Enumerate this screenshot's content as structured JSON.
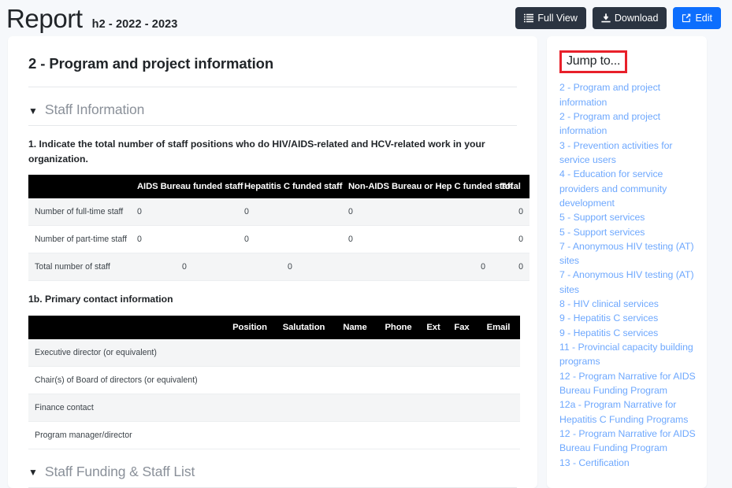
{
  "header": {
    "title": "Report",
    "subtitle": "h2 - 2022 - 2023",
    "buttons": {
      "full_view": "Full View",
      "download": "Download",
      "edit": "Edit"
    },
    "colors": {
      "dark_button": "#2b3441",
      "primary_button": "#0d6efd",
      "page_background": "#f6f8fb"
    }
  },
  "main": {
    "section_title": "2 - Program and project information",
    "accordions": [
      {
        "label": "Staff Information",
        "expanded": true
      },
      {
        "label": "Staff Funding & Staff List",
        "expanded": true
      }
    ],
    "question_1": "1. Indicate the total number of staff positions who do HIV/AIDS-related and HCV-related work in your organization.",
    "staff_table": {
      "columns": [
        "",
        "AIDS Bureau funded staff",
        "Hepatitis C funded staff",
        "Non-AIDS Bureau or Hep C funded staff",
        "Total"
      ],
      "rows": [
        {
          "label": "Number of full-time staff",
          "values": [
            "0",
            "0",
            "0",
            "0"
          ],
          "align": "left"
        },
        {
          "label": "Number of part-time staff",
          "values": [
            "0",
            "0",
            "0",
            "0"
          ],
          "align": "left"
        },
        {
          "label": "Total number of staff",
          "values": [
            "0",
            "0",
            "0",
            "0"
          ],
          "align": "center"
        }
      ]
    },
    "question_1b": "1b. Primary contact information",
    "contact_table": {
      "columns": [
        "",
        "Position",
        "Salutation",
        "Name",
        "Phone",
        "Ext",
        "Fax",
        "Email"
      ],
      "rows": [
        {
          "label": "Executive director (or equivalent)",
          "values": [
            "",
            "",
            "",
            "",
            "",
            "",
            ""
          ]
        },
        {
          "label": "Chair(s) of Board of directors (or equivalent)",
          "values": [
            "",
            "",
            "",
            "",
            "",
            "",
            ""
          ]
        },
        {
          "label": "Finance contact",
          "values": [
            "",
            "",
            "",
            "",
            "",
            "",
            ""
          ]
        },
        {
          "label": "Program manager/director",
          "values": [
            "",
            "",
            "",
            "",
            "",
            "",
            ""
          ]
        }
      ]
    }
  },
  "sidebar": {
    "heading": "Jump to...",
    "heading_highlight_color": "#e8202a",
    "link_color": "#6ea8fe",
    "links": [
      "2 - Program and project information",
      "2 - Program and project information",
      "3 - Prevention activities for service users",
      "4 - Education for service providers and community development",
      "5 - Support services",
      "5 - Support services",
      "7 - Anonymous HIV testing (AT) sites",
      "7 - Anonymous HIV testing (AT) sites",
      "8 - HIV clinical services",
      "9 - Hepatitis C services",
      "9 - Hepatitis C services",
      "11 - Provincial capacity building programs",
      "12 - Program Narrative for AIDS Bureau Funding Program",
      "12a - Program Narrative for Hepatitis C Funding Programs",
      "12 - Program Narrative for AIDS Bureau Funding Program",
      "13 - Certification"
    ]
  }
}
